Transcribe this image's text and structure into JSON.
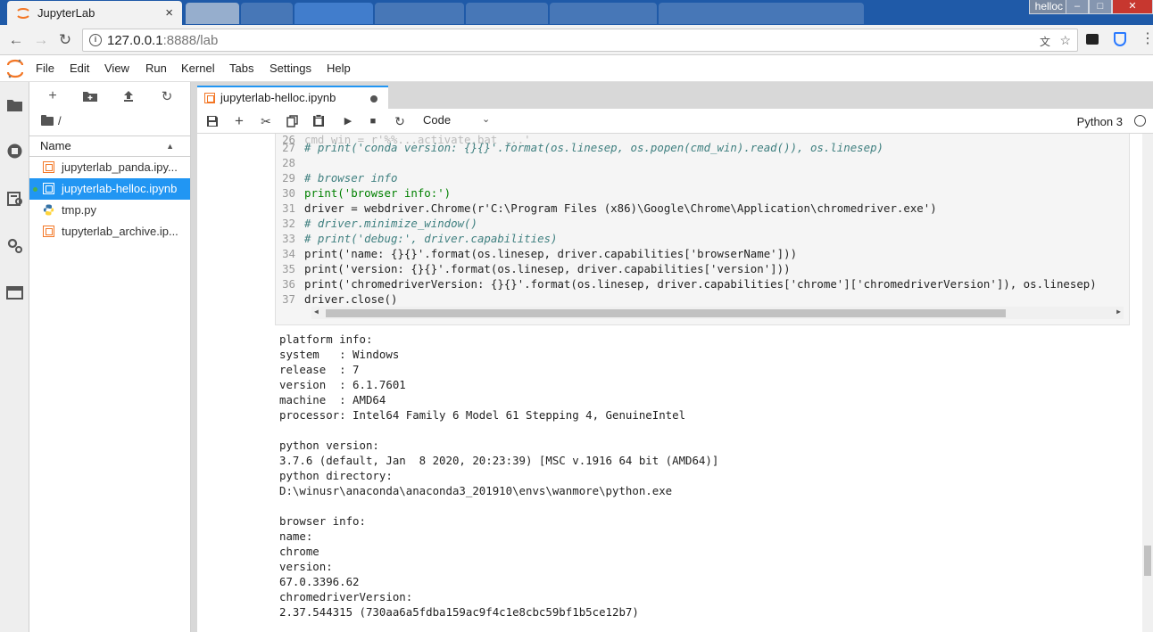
{
  "browser": {
    "tab_title": "JupyterLab",
    "tab_close": "×",
    "window_title": "helloc",
    "url_host": "127.0.0.1",
    "url_path": ":8888/lab",
    "win_min": "–",
    "win_max": "□",
    "win_close": "✕"
  },
  "menu": [
    "File",
    "Edit",
    "View",
    "Run",
    "Kernel",
    "Tabs",
    "Settings",
    "Help"
  ],
  "filebrowser": {
    "path": "/",
    "column_name": "Name",
    "files": [
      {
        "name": "jupyterlab_panda.ipy...",
        "type": "notebook"
      },
      {
        "name": "jupyterlab-helloc.ipynb",
        "type": "notebook"
      },
      {
        "name": "tmp.py",
        "type": "python"
      },
      {
        "name": "tupyterlab_archive.ip...",
        "type": "notebook"
      }
    ],
    "selected_index": 1
  },
  "notebook": {
    "tab_title": "jupyterlab-helloc.ipynb",
    "cell_type": "Code",
    "kernel": "Python 3",
    "code_lines": [
      {
        "n": "27",
        "text": "# print('conda version: {}{}'.format(os.linesep, os.popen(cmd_win).read()), os.linesep)"
      },
      {
        "n": "28",
        "text": ""
      },
      {
        "n": "29",
        "text": "# browser info"
      },
      {
        "n": "30",
        "text": "print('browser info:')"
      },
      {
        "n": "31",
        "text": "driver = webdriver.Chrome(r'C:\\Program Files (x86)\\Google\\Chrome\\Application\\chromedriver.exe')"
      },
      {
        "n": "32",
        "text": "# driver.minimize_window()"
      },
      {
        "n": "33",
        "text": "# print('debug:', driver.capabilities)"
      },
      {
        "n": "34",
        "text": "print('name: {}{}'.format(os.linesep, driver.capabilities['browserName']))"
      },
      {
        "n": "35",
        "text": "print('version: {}{}'.format(os.linesep, driver.capabilities['version']))"
      },
      {
        "n": "36",
        "text": "print('chromedriverVersion: {}{}'.format(os.linesep, driver.capabilities['chrome']['chromedriverVersion']), os.linesep)"
      },
      {
        "n": "37",
        "text": "driver.close()"
      }
    ],
    "output_lines": [
      "platform info:",
      "system   : Windows",
      "release  : 7",
      "version  : 6.1.7601",
      "machine  : AMD64",
      "processor: Intel64 Family 6 Model 61 Stepping 4, GenuineIntel",
      "",
      "python version:",
      "3.7.6 (default, Jan  8 2020, 20:23:39) [MSC v.1916 64 bit (AMD64)]",
      "python directory:",
      "D:\\winusr\\anaconda\\anaconda3_201910\\envs\\wanmore\\python.exe",
      "",
      "browser info:",
      "name:",
      "chrome",
      "version:",
      "67.0.3396.62",
      "chromedriverVersion:",
      "2.37.544315 (730aa6a5fdba159ac9f4c1e8cbc59bf1b5ce12b7)"
    ]
  },
  "colors": {
    "accent": "#2196f3",
    "jupyter_orange": "#f37726",
    "tabstrip": "#1f5aa8"
  }
}
